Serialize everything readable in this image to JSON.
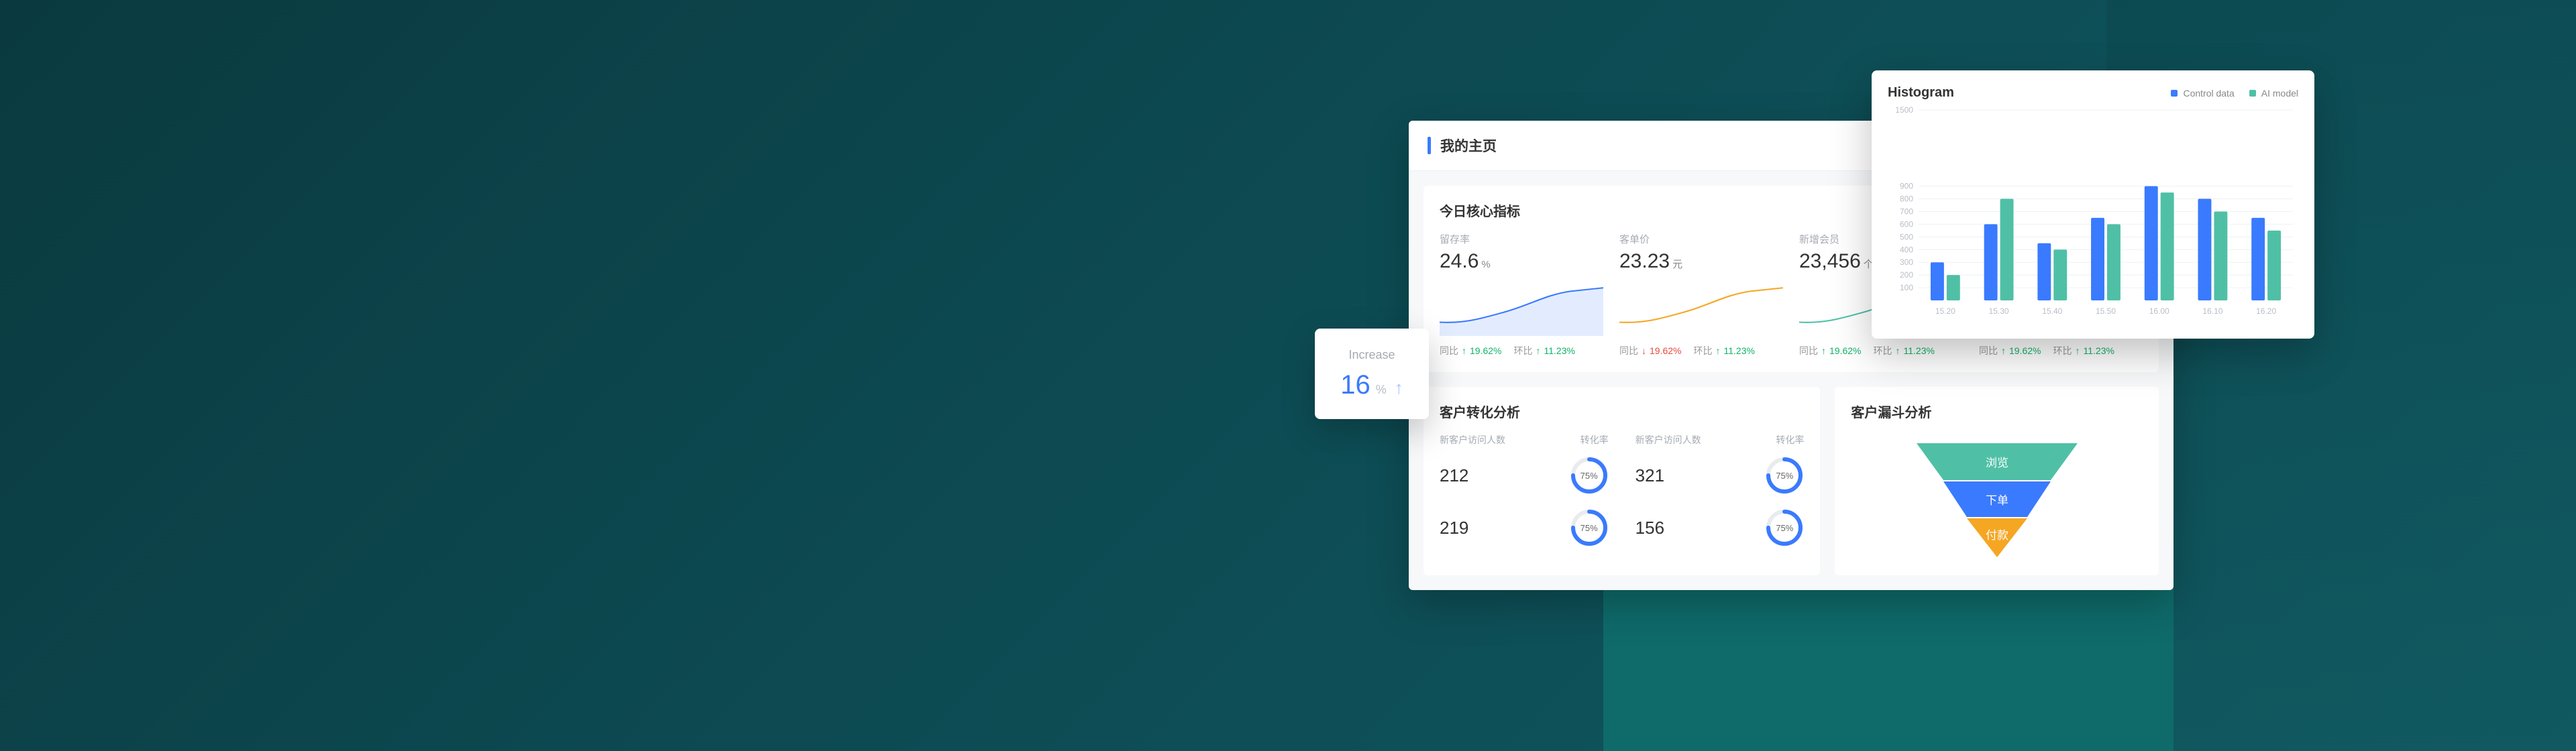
{
  "dashboard": {
    "title": "我的主页",
    "core_section_title": "今日核心指标",
    "metrics": [
      {
        "label": "留存率",
        "value": "24.6",
        "unit": "%"
      },
      {
        "label": "客单价",
        "value": "23.23",
        "unit": "元"
      },
      {
        "label": "新增会员",
        "value": "23,456",
        "unit": "个"
      },
      {
        "label": "",
        "value": "",
        "unit": ""
      }
    ],
    "compare_labels": {
      "tongbi": "同比",
      "huanbi": "环比"
    },
    "compare": [
      {
        "tb": "19.62%",
        "tb_dir": "up",
        "hb": "11.23%",
        "hb_dir": "up"
      },
      {
        "tb": "19.62%",
        "tb_dir": "dn",
        "hb": "11.23%",
        "hb_dir": "up"
      },
      {
        "tb": "19.62%",
        "tb_dir": "up",
        "hb": "11.23%",
        "hb_dir": "up"
      },
      {
        "tb": "19.62%",
        "tb_dir": "up",
        "hb": "11.23%",
        "hb_dir": "up"
      }
    ],
    "conversion": {
      "title": "客户转化分析",
      "col_labels": {
        "visits": "新客户访问人数",
        "rate": "转化率"
      },
      "rows": [
        {
          "value": "212",
          "pct": "75%"
        },
        {
          "value": "321",
          "pct": "75%"
        },
        {
          "value": "219",
          "pct": "75%"
        },
        {
          "value": "156",
          "pct": "75%"
        }
      ]
    },
    "funnel": {
      "title": "客户漏斗分析",
      "steps": [
        {
          "label": "浏览",
          "color": "#4fc0a6"
        },
        {
          "label": "下单",
          "color": "#3a7afe"
        },
        {
          "label": "付款",
          "color": "#f5a623"
        }
      ]
    }
  },
  "increase": {
    "label": "Increase",
    "value": "16",
    "unit": "%"
  },
  "histogram": {
    "title": "Histogram",
    "legend": {
      "a": "Control data",
      "b": "AI model"
    }
  },
  "chart_data": {
    "type": "bar",
    "title": "Histogram",
    "xlabel": "",
    "ylabel": "",
    "categories": [
      "15.20",
      "15.30",
      "15.40",
      "15.50",
      "16.00",
      "16.10",
      "16.20"
    ],
    "series": [
      {
        "name": "Control data",
        "color": "#3a7afe",
        "values": [
          300,
          600,
          450,
          650,
          900,
          800,
          650
        ]
      },
      {
        "name": "AI model",
        "color": "#4fc0a6",
        "values": [
          200,
          800,
          400,
          600,
          850,
          700,
          550
        ]
      }
    ],
    "ylim": [
      0,
      1500
    ],
    "yticks": [
      100,
      200,
      300,
      400,
      500,
      600,
      700,
      800,
      900,
      1500
    ]
  }
}
